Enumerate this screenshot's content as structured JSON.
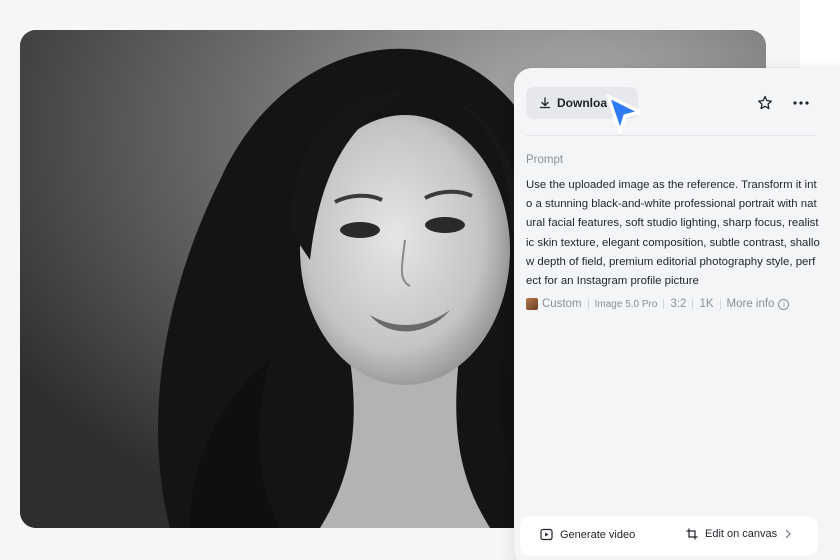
{
  "toolbar": {
    "download_label": "Downloa",
    "download_icon": "download-icon",
    "favorite_icon": "star-icon",
    "more_icon": "more-horizontal-icon"
  },
  "prompt": {
    "label": "Prompt",
    "text": "Use the uploaded image as the reference. Transform it into a stunning black-and-white professional portrait with natural facial features, soft studio lighting, sharp focus, realistic skin texture, elegant composition, subtle contrast, shallow depth of field, premium editorial photography style, perfect for an Instagram profile picture"
  },
  "meta": {
    "style": "Custom",
    "model": "Image 5.0 Pro",
    "ratio": "3:2",
    "resolution": "1K",
    "more_info": "More info"
  },
  "actions": {
    "generate_video": "Generate video",
    "edit_on_canvas": "Edit on canvas"
  },
  "colors": {
    "accent_cursor": "#2f7bf5",
    "panel_bg": "#f4f5f7",
    "button_bg": "#e6e8eb"
  }
}
